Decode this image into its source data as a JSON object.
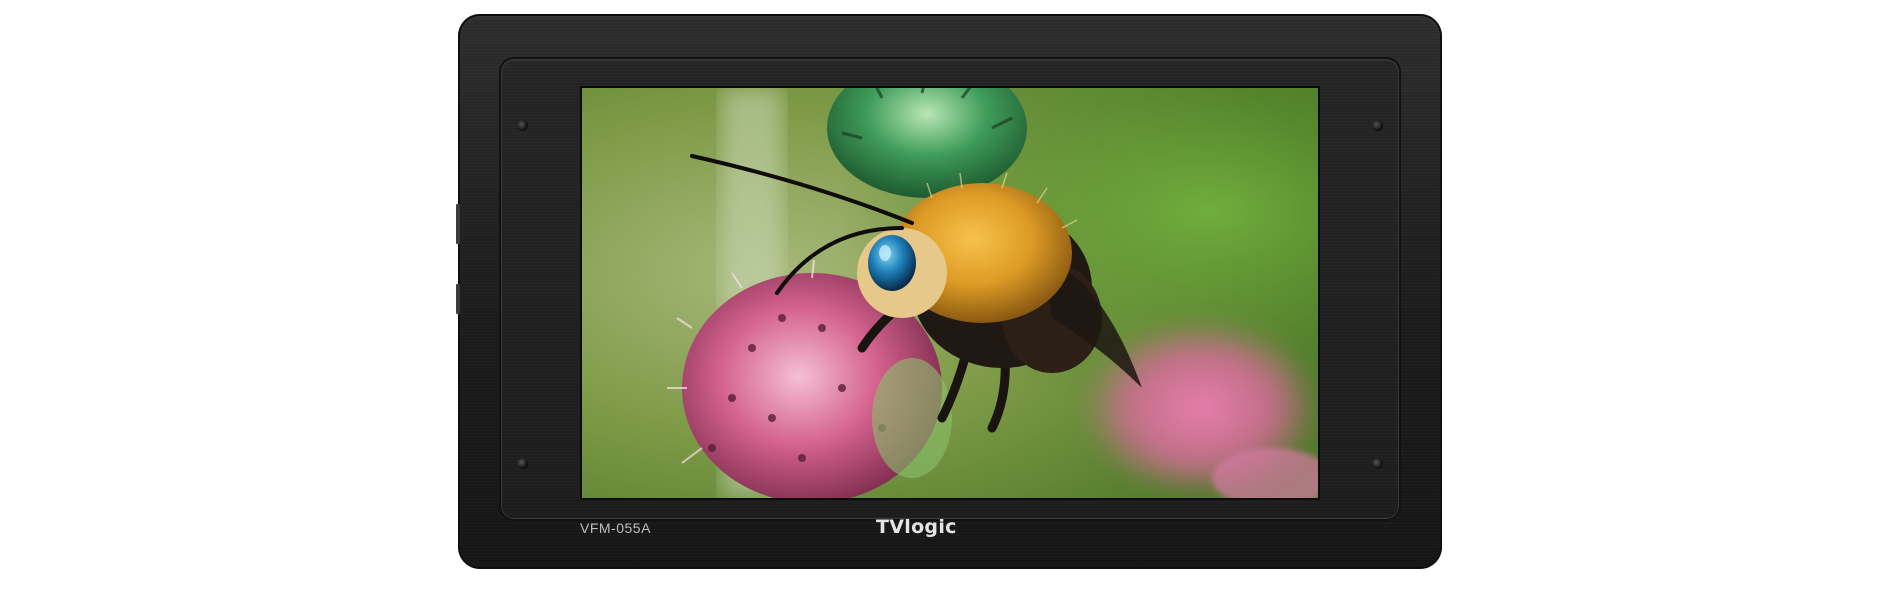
{
  "device": {
    "model": "VFM-055A",
    "brand": "TVlogic"
  },
  "screen": {
    "content": "photo-bee-on-thistle"
  },
  "colors": {
    "body": "#1c1c1c",
    "label_text": "#bdbdbd",
    "logo_text": "#e4e4e4"
  }
}
